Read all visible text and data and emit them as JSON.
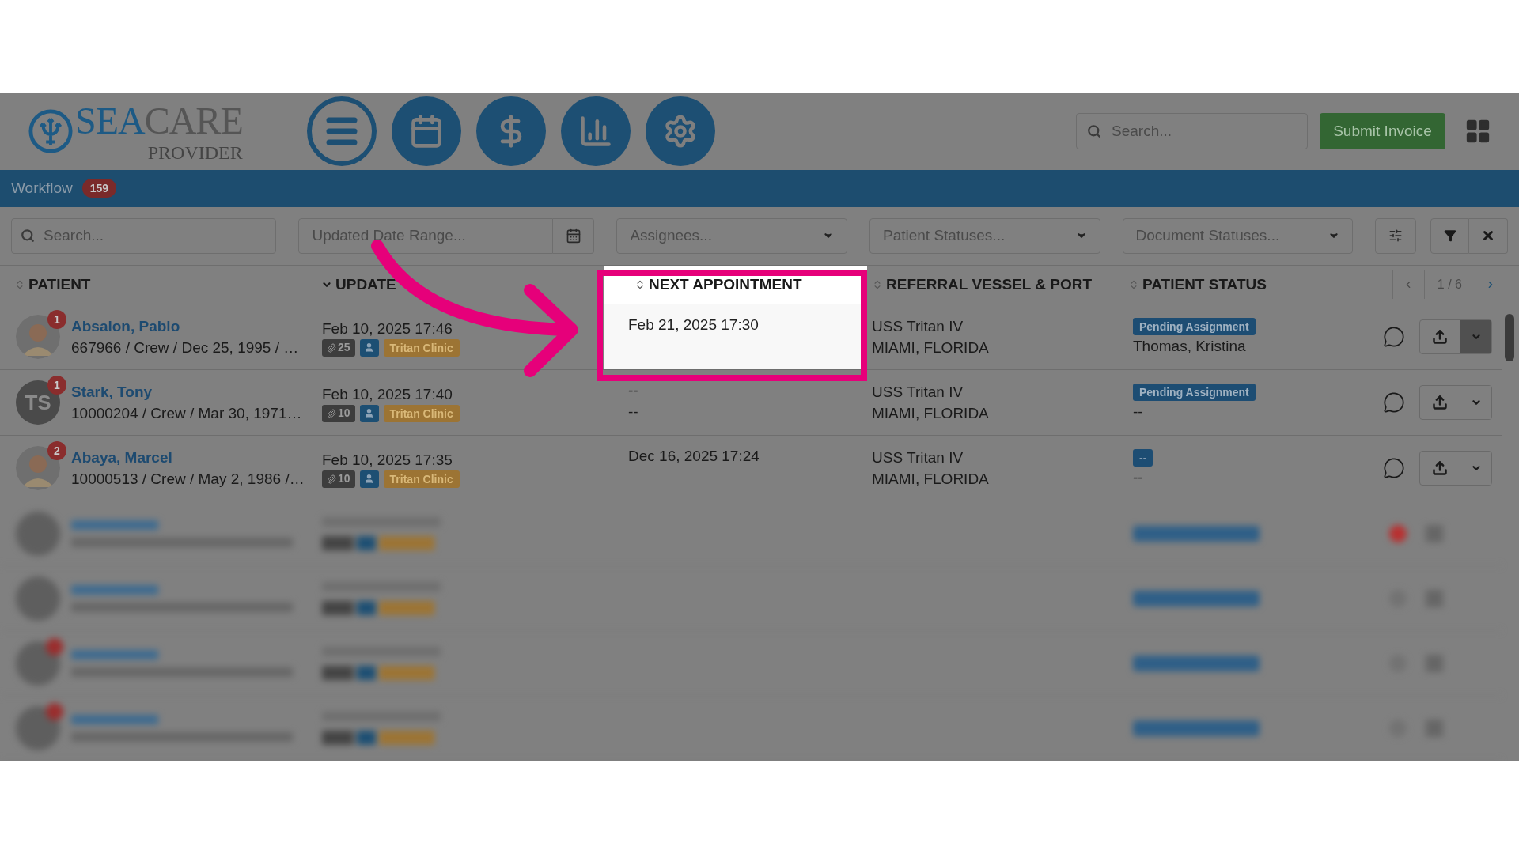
{
  "logo": {
    "primary": "SEA",
    "secondary": "CARE",
    "subtitle": "PROVIDER"
  },
  "nav_buttons": [
    {
      "kind": "menu",
      "selected": true
    },
    {
      "kind": "calendar",
      "selected": false
    },
    {
      "kind": "billing",
      "selected": false
    },
    {
      "kind": "reports",
      "selected": false
    },
    {
      "kind": "settings",
      "selected": false
    }
  ],
  "header_search": {
    "placeholder": "Search..."
  },
  "submit_button": "Submit Invoice",
  "workflow_tab": {
    "label": "Workflow",
    "count": "159"
  },
  "filters": {
    "search": {
      "placeholder": "Search..."
    },
    "date_range": {
      "placeholder": "Updated Date Range..."
    },
    "assignees": "Assignees...",
    "patient_statuses": "Patient Statuses...",
    "document_statuses": "Document Statuses..."
  },
  "columns": [
    {
      "label": "PATIENT",
      "sorted_descending": false,
      "highlighted": false
    },
    {
      "label": "UPDATE",
      "sorted_descending": true,
      "highlighted": false
    },
    {
      "label": "NEXT APPOINTMENT",
      "sorted_descending": false,
      "highlighted": true
    },
    {
      "label": "REFERRAL VESSEL & PORT",
      "sorted_descending": false,
      "highlighted": false
    },
    {
      "label": "PATIENT STATUS",
      "sorted_descending": false,
      "highlighted": false
    }
  ],
  "pagination": "1 / 6",
  "rows": [
    {
      "photo": true,
      "badge": "1",
      "name": "Absalon, Pablo",
      "details": "667966 / Crew / Dec 25, 1995 / …",
      "updated": "Feb 10, 2025 17:46",
      "attachments": "25",
      "clinic": "Tritan Clinic",
      "appointment": [
        "Feb 21, 2025 17:30"
      ],
      "highlighted": true,
      "vessel": "USS Tritan IV",
      "port": "MIAMI, FLORIDA",
      "status": "Pending Assignment",
      "assignee": "Thomas, Kristina",
      "menu_open": true
    },
    {
      "photo": false,
      "initials": "TS",
      "badge": "1",
      "name": "Stark, Tony",
      "details": "10000204 / Crew / Mar 30, 1971…",
      "updated": "Feb 10, 2025 17:40",
      "attachments": "10",
      "clinic": "Tritan Clinic",
      "appointment": [
        "--",
        "--"
      ],
      "highlighted": false,
      "vessel": "USS Tritan IV",
      "port": "MIAMI, FLORIDA",
      "status": "Pending Assignment",
      "assignee": "--",
      "menu_open": false
    },
    {
      "photo": true,
      "badge": "2",
      "name": "Abaya, Marcel",
      "details": "10000513 / Crew / May 2, 1986 /…",
      "updated": "Feb 10, 2025 17:35",
      "attachments": "10",
      "clinic": "Tritan Clinic",
      "appointment": [
        "Dec 16, 2025 17:24"
      ],
      "highlighted": false,
      "vessel": "USS Tritan IV",
      "port": "MIAMI, FLORIDA",
      "status": "--",
      "assignee": "--",
      "menu_open": false
    }
  ],
  "blurred_rows": [
    {
      "kind": "blurred",
      "badge": false,
      "alert": true
    },
    {
      "kind": "blurred",
      "badge": false,
      "alert": false
    },
    {
      "kind": "blurred",
      "badge": true,
      "alert": false
    },
    {
      "kind": "blurred",
      "badge": true,
      "alert": false
    }
  ]
}
